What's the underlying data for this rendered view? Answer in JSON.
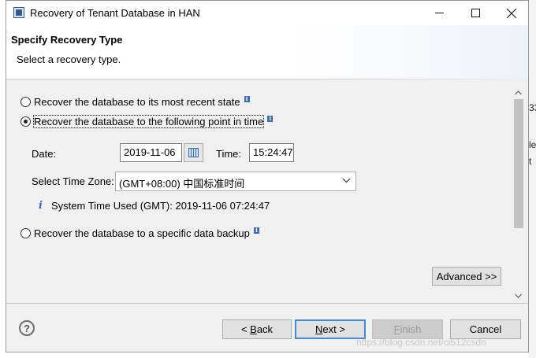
{
  "window": {
    "title": "Recovery of Tenant Database in HAN",
    "minimize_icon": "minimize-icon",
    "maximize_icon": "maximize-icon",
    "close_icon": "close-icon"
  },
  "header": {
    "title": "Specify Recovery Type",
    "subtitle": "Select a recovery type."
  },
  "options": {
    "most_recent": {
      "label": "Recover the database to its most recent state",
      "checked": false
    },
    "point_in_time": {
      "label": "Recover the database to the following point in time",
      "checked": true
    },
    "data_backup": {
      "label": "Recover the database to a specific data backup",
      "checked": false
    }
  },
  "point_in_time": {
    "date_label": "Date:",
    "date_value": "2019-11-06",
    "time_label": "Time:",
    "time_value": "15:24:47",
    "timezone_label": "Select Time Zone:",
    "timezone_value": "(GMT+08:00) 中国标准时间",
    "system_time_info": "System Time Used (GMT): 2019-11-06 07:24:47"
  },
  "buttons": {
    "advanced": "Advanced >>",
    "back_prefix": "< ",
    "back_key": "B",
    "back_rest": "ack",
    "next_key": "N",
    "next_rest": "ext >",
    "finish_key": "F",
    "finish_rest": "inish",
    "cancel": "Cancel"
  },
  "background": {
    "fragment_1": "33",
    "fragment_2": "le",
    "fragment_3": "t",
    "watermark": "https://blog.csdn.net/ci512csdn"
  },
  "colors": {
    "accent": "#3c8fd6",
    "info_icon": "#3b6db4",
    "dialog_bg": "#f0f0f0"
  }
}
